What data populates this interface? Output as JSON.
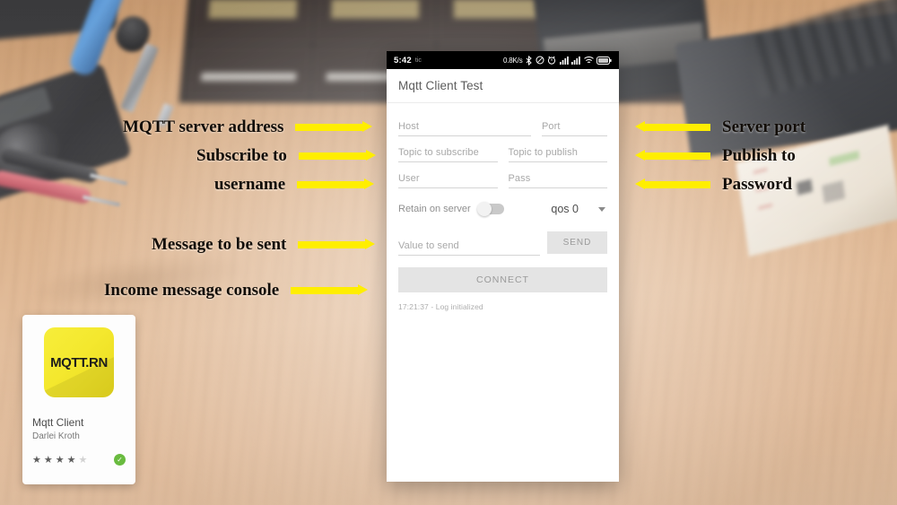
{
  "background": {
    "description": "blurred electronics workbench photo",
    "objects": [
      "multimeter",
      "soldering-iron",
      "component-drawers",
      "test-probes",
      "laptop",
      "paper-schematic"
    ]
  },
  "phone": {
    "statusbar": {
      "time": "5:42",
      "carrier": "tic",
      "data_rate": "0.8K/s",
      "icons": [
        "bluetooth-icon",
        "mute-icon",
        "alarm-icon",
        "signal-1-icon",
        "signal-2-icon",
        "wifi-icon",
        "battery-icon"
      ]
    },
    "appbar": {
      "title": "Mqtt Client Test"
    },
    "fields": {
      "host": "Host",
      "port": "Port",
      "topic_subscribe": "Topic to subscribe",
      "topic_publish": "Topic to publish",
      "user": "User",
      "pass": "Pass",
      "value_to_send": "Value to send"
    },
    "controls": {
      "retain_label": "Retain on server",
      "retain_on": false,
      "qos_value": "qos 0",
      "send_label": "SEND",
      "connect_label": "CONNECT"
    },
    "log": {
      "line": "17:21:37 - Log initialized"
    }
  },
  "annotations": {
    "left": [
      {
        "label": "MQTT server address",
        "direction": "right"
      },
      {
        "label": "Subscribe to",
        "direction": "right"
      },
      {
        "label": "username",
        "direction": "right"
      },
      {
        "label": "Message to be sent",
        "direction": "right"
      },
      {
        "label": "Income message console",
        "direction": "right"
      }
    ],
    "right": [
      {
        "label": "Server port",
        "direction": "left"
      },
      {
        "label": "Publish to",
        "direction": "left"
      },
      {
        "label": "Password",
        "direction": "left"
      }
    ],
    "arrow_color": "#ffee00"
  },
  "app_card": {
    "icon_text": "MQTT.RN",
    "icon_color": "#f4e82e",
    "title": "Mqtt Client",
    "developer": "Darlei Kroth",
    "rating": 4,
    "rating_max": 5,
    "verified_icon": "check-icon"
  }
}
